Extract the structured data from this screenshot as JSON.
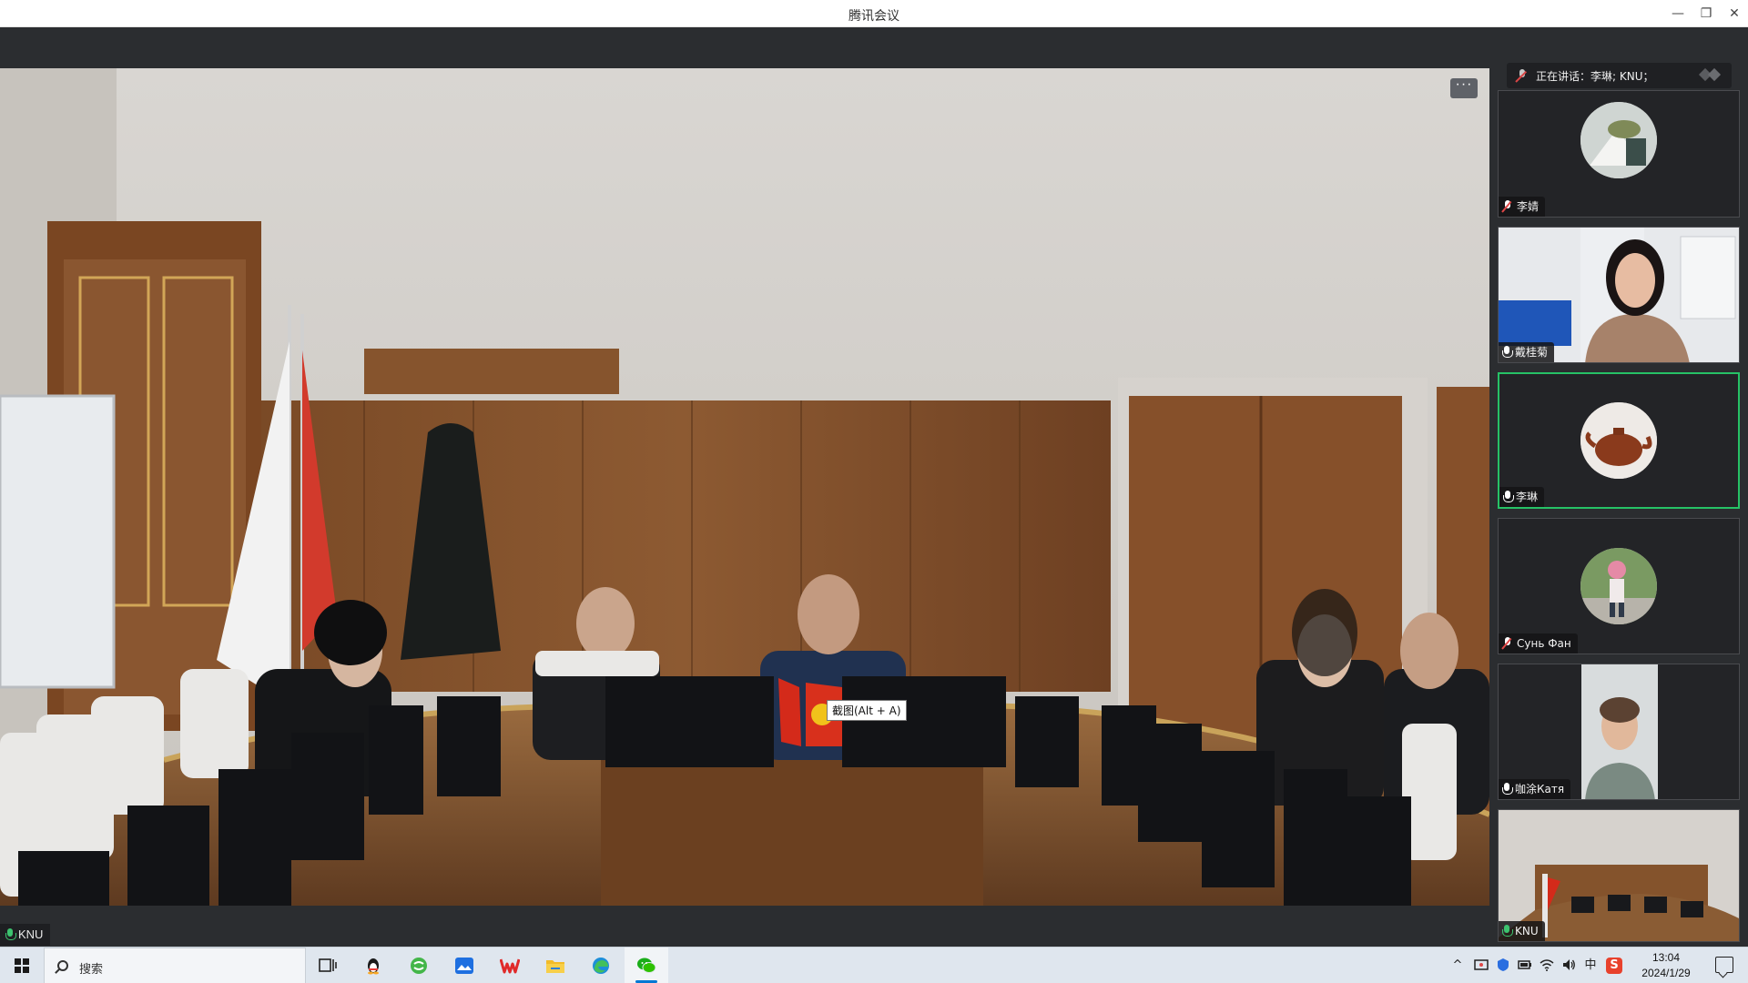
{
  "window": {
    "title": "腾讯会议",
    "controls": {
      "minimize": "—",
      "restore": "❐",
      "close": "✕"
    }
  },
  "main_video": {
    "more_label": "···",
    "screenshot_tooltip": "截图(Alt + A)",
    "participant_name": "KNU"
  },
  "speaking": {
    "text": "正在讲话：李琳; KNU；"
  },
  "participants": [
    {
      "name": "李婧",
      "mic": "muted"
    },
    {
      "name": "戴桂菊",
      "mic": "on"
    },
    {
      "name": "李琳",
      "mic": "on",
      "active": true
    },
    {
      "name": "Сунь Фан",
      "mic": "muted"
    },
    {
      "name": "咖涂Катя",
      "mic": "on"
    },
    {
      "name": "KNU",
      "mic": "on"
    }
  ],
  "taskbar": {
    "search_placeholder": "搜索",
    "apps": [
      "task-view",
      "qq",
      "green-app",
      "blue-app",
      "wps",
      "file-explorer",
      "edge",
      "wechat"
    ],
    "tray": {
      "chevron": "^",
      "ime": "中",
      "sogou": "S",
      "time": "13:04",
      "date": "2024/1/29"
    }
  },
  "colors": {
    "active_border": "#26c266",
    "mic_green": "#3cc36f",
    "muted_red": "#e04848",
    "taskbar_accent": "#0078d4"
  }
}
